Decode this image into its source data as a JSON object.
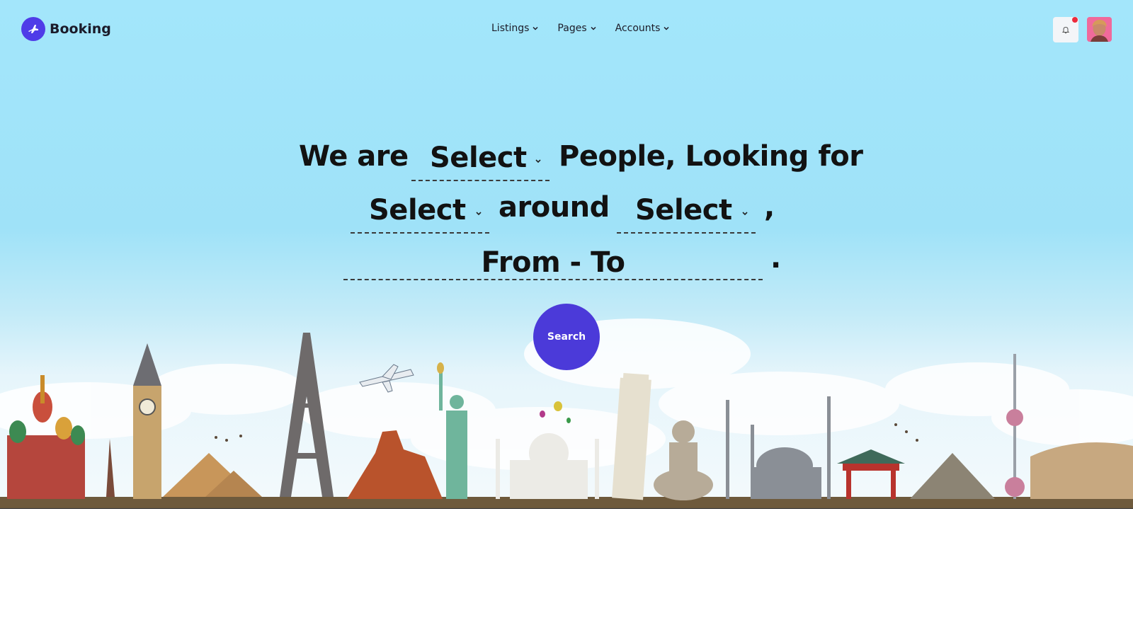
{
  "header": {
    "brand": "Booking",
    "nav": [
      {
        "label": "Listings"
      },
      {
        "label": "Pages"
      },
      {
        "label": "Accounts"
      }
    ]
  },
  "hero": {
    "sentence": {
      "part1": "We are",
      "select1": "Select",
      "part2": "People, Looking for",
      "select2": "Select",
      "part3": "around",
      "select3": "Select",
      "comma": ",",
      "dates": "From - To",
      "period": "."
    },
    "search_label": "Search"
  },
  "colors": {
    "brand": "#4b3ad9",
    "sky": "#a3e6fb",
    "notification_dot": "#ec2b3c"
  },
  "icons": [
    "plane-logo-icon",
    "chevron-down-icon",
    "bell-icon",
    "user-avatar"
  ]
}
